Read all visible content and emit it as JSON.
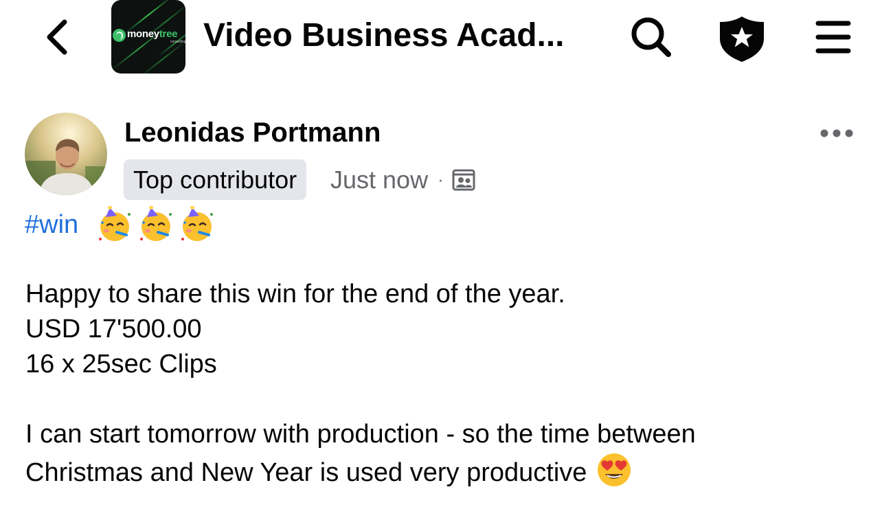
{
  "header": {
    "back_icon": "chevron-left-icon",
    "group_logo": {
      "brand_primary": "money",
      "brand_accent": "tree",
      "brand_sub": "consulting"
    },
    "group_title": "Video Business Acad...",
    "search_icon": "search-icon",
    "shield_icon": "shield-star-icon",
    "menu_icon": "hamburger-menu-icon"
  },
  "post": {
    "author": "Leonidas Portmann",
    "badge": "Top contributor",
    "timestamp": "Just now",
    "separator": "·",
    "audience_icon": "group-members-icon",
    "more_icon": "more-horizontal-icon",
    "hashtag": "#win",
    "hashtag_emojis": [
      "partying-face",
      "partying-face",
      "partying-face"
    ],
    "lines": [
      "Happy to share this win for the end of the year.",
      "USD 17'500.00",
      "16 x 25sec Clips",
      "I can start tomorrow with production - so the time between",
      "Christmas and New Year is used very productive"
    ],
    "trailing_emoji": "heart-eyes-face"
  },
  "colors": {
    "hashtag_blue": "#216fdb",
    "badge_bg": "#e4e6eb",
    "meta_gray": "#65676b",
    "text": "#050505",
    "brand_green": "#3cc06a"
  }
}
